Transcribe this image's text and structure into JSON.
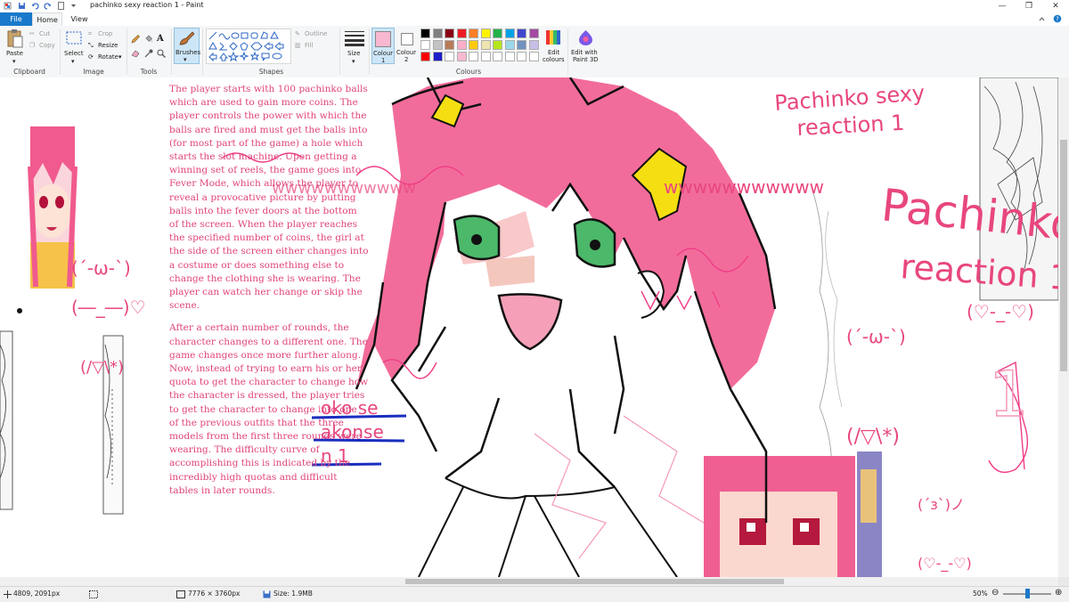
{
  "window": {
    "title": "pachinko sexy reaction 1 - Paint",
    "minimize_glyph": "—",
    "maximize_glyph": "❐",
    "close_glyph": "✕"
  },
  "tabs": [
    "File",
    "Home",
    "View"
  ],
  "ribbon": {
    "clipboard": {
      "paste": "Paste",
      "cut": "Cut",
      "copy": "Copy",
      "group": "Clipboard"
    },
    "image": {
      "select": "Select",
      "crop": "Crop",
      "resize": "Resize",
      "rotate": "Rotate",
      "group": "Image"
    },
    "tools": {
      "group": "Tools"
    },
    "brushes": {
      "label": "Brushes"
    },
    "shapes": {
      "outline": "Outline",
      "fill": "Fill",
      "group": "Shapes"
    },
    "size": {
      "label": "Size"
    },
    "colours": {
      "colour1": "Colour\n1",
      "colour1_line1": "Colour",
      "colour1_line2": "1",
      "colour2_line1": "Colour",
      "colour2_line2": "2",
      "edit_colours_line1": "Edit",
      "edit_colours_line2": "colours",
      "group": "Colours",
      "colour1_value": "#f7b8d0",
      "colour2_value": "#ffffff",
      "palette_row1": [
        "#000000",
        "#7f7f7f",
        "#880015",
        "#ed1c24",
        "#ff7f27",
        "#fff200",
        "#22b14c",
        "#00a2e8",
        "#3f48cc",
        "#a349a4"
      ],
      "palette_row2": [
        "#ffffff",
        "#c3c3c3",
        "#b97a57",
        "#ffaec9",
        "#ffc90e",
        "#efe4b0",
        "#b5e61d",
        "#99d9ea",
        "#7092be",
        "#c8bfe7"
      ],
      "palette_row3": [
        "#ff0000",
        "#1e1ec8",
        "#ffffff",
        "#f7b8d0",
        "#ffffff",
        "#ffffff",
        "#ffffff",
        "#ffffff",
        "#ffffff",
        "#ffffff"
      ]
    },
    "paint3d": {
      "line1": "Edit with",
      "line2": "Paint 3D"
    }
  },
  "canvas": {
    "article_paragraphs": [
      "The player starts with 100 pachinko balls which are used to gain more coins. The player controls the power with which the balls are fired and must get the balls into (for most part of the game) a hole which starts the slot machine. Upon getting a winning set of reels, the game goes into Fever Mode, which allows the player to reveal a provocative picture by putting balls into the fever doors at the bottom of the screen. When the player reaches the specified number of coins, the girl at the side of the screen either changes into a costume or does something else to change the clothing she is wearing. The player can watch her change or skip the scene.",
      "After a certain number of rounds, the character changes to a different one. The game changes once more further along. Now, instead of trying to earn his or her quota to get the character to change how the character is dressed, the player tries to get the character to change into one of the previous outfits that the three models from the first three rounds were wearing. The difficulty curve of accomplishing this is indicated by the incredibly high quotas and difficult tables in later rounds."
    ],
    "handwriting": {
      "title_small_line1": "Pachinko sexy",
      "title_small_line2": "reaction 1",
      "title_big_line1": "Pachinko",
      "title_big_line2": "reaction 1",
      "emoticon_1": "(´-ω-`)",
      "emoticon_2": "(♡-_-♡)",
      "emoticon_3": "(/▽\\*)",
      "emoticon_4": "(´з`)ノ",
      "emoticon_5": "(―_―)♡",
      "laugh": "wwwwwwwwwww",
      "digit": "1",
      "blue_line1": "oko se",
      "blue_line2": "akonse",
      "blue_line3": "n 1"
    }
  },
  "status": {
    "cursor": "4809, 2091px",
    "dimensions": "7776 × 3760px",
    "size": "Size: 1.9MB",
    "zoom": "50%",
    "zoom_fraction": 0.5
  }
}
